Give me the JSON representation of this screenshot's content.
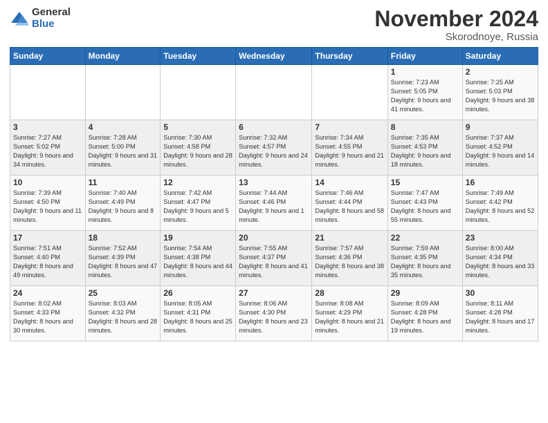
{
  "logo": {
    "general": "General",
    "blue": "Blue"
  },
  "title": "November 2024",
  "location": "Skorodnoye, Russia",
  "weekdays": [
    "Sunday",
    "Monday",
    "Tuesday",
    "Wednesday",
    "Thursday",
    "Friday",
    "Saturday"
  ],
  "weeks": [
    [
      {
        "day": "",
        "info": ""
      },
      {
        "day": "",
        "info": ""
      },
      {
        "day": "",
        "info": ""
      },
      {
        "day": "",
        "info": ""
      },
      {
        "day": "",
        "info": ""
      },
      {
        "day": "1",
        "info": "Sunrise: 7:23 AM\nSunset: 5:05 PM\nDaylight: 9 hours and 41 minutes."
      },
      {
        "day": "2",
        "info": "Sunrise: 7:25 AM\nSunset: 5:03 PM\nDaylight: 9 hours and 38 minutes."
      }
    ],
    [
      {
        "day": "3",
        "info": "Sunrise: 7:27 AM\nSunset: 5:02 PM\nDaylight: 9 hours and 34 minutes."
      },
      {
        "day": "4",
        "info": "Sunrise: 7:28 AM\nSunset: 5:00 PM\nDaylight: 9 hours and 31 minutes."
      },
      {
        "day": "5",
        "info": "Sunrise: 7:30 AM\nSunset: 4:58 PM\nDaylight: 9 hours and 28 minutes."
      },
      {
        "day": "6",
        "info": "Sunrise: 7:32 AM\nSunset: 4:57 PM\nDaylight: 9 hours and 24 minutes."
      },
      {
        "day": "7",
        "info": "Sunrise: 7:34 AM\nSunset: 4:55 PM\nDaylight: 9 hours and 21 minutes."
      },
      {
        "day": "8",
        "info": "Sunrise: 7:35 AM\nSunset: 4:53 PM\nDaylight: 9 hours and 18 minutes."
      },
      {
        "day": "9",
        "info": "Sunrise: 7:37 AM\nSunset: 4:52 PM\nDaylight: 9 hours and 14 minutes."
      }
    ],
    [
      {
        "day": "10",
        "info": "Sunrise: 7:39 AM\nSunset: 4:50 PM\nDaylight: 9 hours and 11 minutes."
      },
      {
        "day": "11",
        "info": "Sunrise: 7:40 AM\nSunset: 4:49 PM\nDaylight: 9 hours and 8 minutes."
      },
      {
        "day": "12",
        "info": "Sunrise: 7:42 AM\nSunset: 4:47 PM\nDaylight: 9 hours and 5 minutes."
      },
      {
        "day": "13",
        "info": "Sunrise: 7:44 AM\nSunset: 4:46 PM\nDaylight: 9 hours and 1 minute."
      },
      {
        "day": "14",
        "info": "Sunrise: 7:46 AM\nSunset: 4:44 PM\nDaylight: 8 hours and 58 minutes."
      },
      {
        "day": "15",
        "info": "Sunrise: 7:47 AM\nSunset: 4:43 PM\nDaylight: 8 hours and 55 minutes."
      },
      {
        "day": "16",
        "info": "Sunrise: 7:49 AM\nSunset: 4:42 PM\nDaylight: 8 hours and 52 minutes."
      }
    ],
    [
      {
        "day": "17",
        "info": "Sunrise: 7:51 AM\nSunset: 4:40 PM\nDaylight: 8 hours and 49 minutes."
      },
      {
        "day": "18",
        "info": "Sunrise: 7:52 AM\nSunset: 4:39 PM\nDaylight: 8 hours and 47 minutes."
      },
      {
        "day": "19",
        "info": "Sunrise: 7:54 AM\nSunset: 4:38 PM\nDaylight: 8 hours and 44 minutes."
      },
      {
        "day": "20",
        "info": "Sunrise: 7:55 AM\nSunset: 4:37 PM\nDaylight: 8 hours and 41 minutes."
      },
      {
        "day": "21",
        "info": "Sunrise: 7:57 AM\nSunset: 4:36 PM\nDaylight: 8 hours and 38 minutes."
      },
      {
        "day": "22",
        "info": "Sunrise: 7:59 AM\nSunset: 4:35 PM\nDaylight: 8 hours and 35 minutes."
      },
      {
        "day": "23",
        "info": "Sunrise: 8:00 AM\nSunset: 4:34 PM\nDaylight: 8 hours and 33 minutes."
      }
    ],
    [
      {
        "day": "24",
        "info": "Sunrise: 8:02 AM\nSunset: 4:33 PM\nDaylight: 8 hours and 30 minutes."
      },
      {
        "day": "25",
        "info": "Sunrise: 8:03 AM\nSunset: 4:32 PM\nDaylight: 8 hours and 28 minutes."
      },
      {
        "day": "26",
        "info": "Sunrise: 8:05 AM\nSunset: 4:31 PM\nDaylight: 8 hours and 25 minutes."
      },
      {
        "day": "27",
        "info": "Sunrise: 8:06 AM\nSunset: 4:30 PM\nDaylight: 8 hours and 23 minutes."
      },
      {
        "day": "28",
        "info": "Sunrise: 8:08 AM\nSunset: 4:29 PM\nDaylight: 8 hours and 21 minutes."
      },
      {
        "day": "29",
        "info": "Sunrise: 8:09 AM\nSunset: 4:28 PM\nDaylight: 8 hours and 19 minutes."
      },
      {
        "day": "30",
        "info": "Sunrise: 8:11 AM\nSunset: 4:28 PM\nDaylight: 8 hours and 17 minutes."
      }
    ]
  ]
}
